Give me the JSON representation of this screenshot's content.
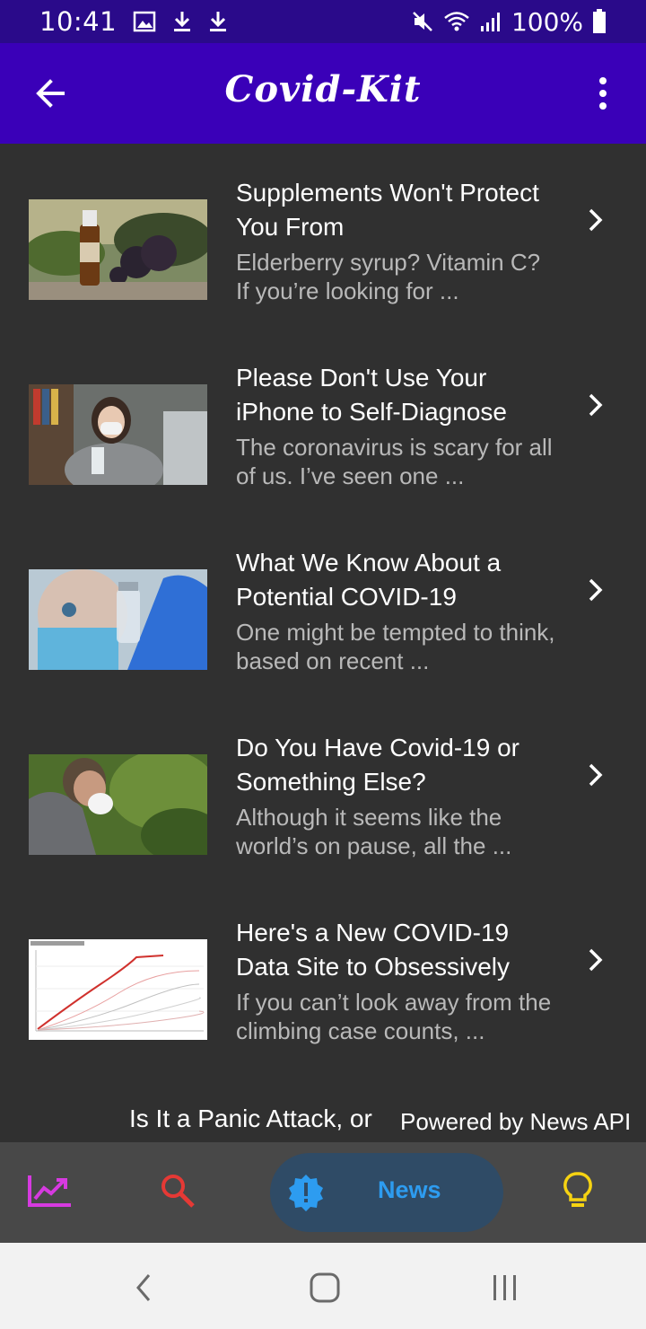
{
  "status_bar": {
    "time": "10:41",
    "battery": "100%"
  },
  "app_bar": {
    "title": "Covid-Kit"
  },
  "articles": [
    {
      "title": "Supplements Won't Protect You From",
      "description": "Elderberry syrup? Vitamin C? If you’re looking for ...",
      "thumbnail": "elderberry-bottle-image"
    },
    {
      "title": "Please Don't Use Your iPhone to Self-Diagnose",
      "description": "The coronavirus is scary for all of us. I’ve seen one ...",
      "thumbnail": "woman-mask-sanitizer-image"
    },
    {
      "title": "What We Know About a Potential COVID-19",
      "description": "One might be tempted to think, based on recent ...",
      "thumbnail": "vaccine-vial-image"
    },
    {
      "title": "Do You Have Covid-19 or Something Else?",
      "description": "Although it seems like the world’s on pause, all the ...",
      "thumbnail": "man-sneezing-image"
    },
    {
      "title": "Here's a New COVID-19 Data Site to Obsessively",
      "description": "If you can’t look away from the climbing case counts, ...",
      "thumbnail": "case-chart-image"
    }
  ],
  "partial_article": {
    "title": "Is It a Panic Attack, or"
  },
  "attribution": "Powered by News API",
  "bottom_nav": {
    "items": [
      {
        "icon": "trending-up-icon",
        "color": "#d63ae0"
      },
      {
        "icon": "search-icon",
        "color": "#e53935"
      },
      {
        "icon": "news-alert-icon",
        "label": "News",
        "color": "#2d9cf0",
        "active": true
      },
      {
        "icon": "lightbulb-icon",
        "color": "#f6d312"
      }
    ]
  },
  "colors": {
    "status_bar": "#2a0a8a",
    "app_bar": "#3a00b8",
    "background": "#303030",
    "bottom_nav": "#484848"
  }
}
